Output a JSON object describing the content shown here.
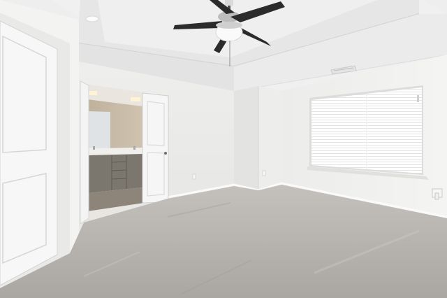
{
  "photo": {
    "subject": "empty-bedroom",
    "palette": {
      "ceiling": "#f2f2f2",
      "tray_ceiling": "#e9e9e9",
      "wall_light": "#f1f1f0",
      "wall_shadow": "#e2e2e0",
      "carpet": "#b9b6b2",
      "door": "#f7f7f7",
      "bath_wall": "#c8bba7",
      "vanity": "#7d7870",
      "fan_blade": "#2b2b2b",
      "window_glow": "#ffffff"
    }
  }
}
